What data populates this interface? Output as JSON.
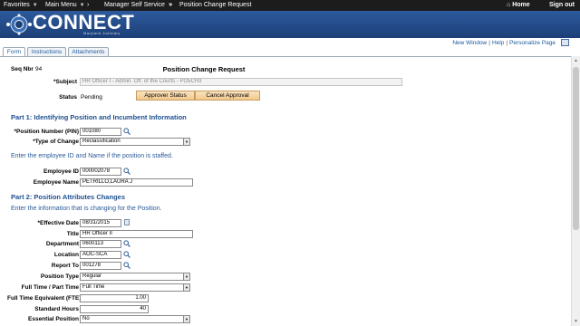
{
  "topbar": {
    "favorites": "Favorites",
    "main_menu": "Main Menu",
    "manager_self_service": "Manager Self Service",
    "page": "Position Change Request",
    "home": "Home",
    "sign_out": "Sign out"
  },
  "brand": {
    "name": "CONNECT",
    "subtitle": "Maryland Judiciary"
  },
  "tabs": [
    "Form",
    "Instructions",
    "Attachments"
  ],
  "links": [
    "New Window",
    "Help",
    "Personalize Page"
  ],
  "form": {
    "title": "Position Change Request",
    "seq_label": "Seq Nbr",
    "seq_value": "94",
    "subject_label": "*Subject",
    "subject_value": "HR Officer I - Admin. Off. of the Courts - PO5CH3",
    "status_label": "Status",
    "status_value": "Pending",
    "approver_status_btn": "Approver Status",
    "cancel_approval_btn": "Cancel Approval"
  },
  "part1": {
    "heading": "Part 1: Identifying Position and Incumbent Information",
    "position_number_label": "*Position Number (PIN)",
    "position_number_value": "001080",
    "type_of_change_label": "*Type of Change",
    "type_of_change_value": "Reclassification",
    "instruction": "Enter the employee ID and Name if the position is staffed.",
    "employee_id_label": "Employee ID",
    "employee_id_value": "000002078",
    "employee_name_label": "Employee Name",
    "employee_name_value": "PETRILLO,LAURA J"
  },
  "part2": {
    "heading": "Part 2: Position Attributes Changes",
    "instruction": "Enter the information that is changing for the Position.",
    "effective_date_label": "*Effective Date",
    "effective_date_value": "08/31/2015",
    "title_label": "Title",
    "title_value": "HR Officer II",
    "department_label": "Department",
    "department_value": "0600113",
    "location_label": "Location",
    "location_value": "AOC-SCA",
    "report_to_label": "Report To",
    "report_to_value": "001278",
    "position_type_label": "Position Type",
    "position_type_value": "Regular",
    "full_part_time_label": "Full Time / Part Time",
    "full_part_time_value": "Full Time",
    "fte_label": "Full Time Equivalent (FTE)",
    "fte_value": "1.00",
    "standard_hours_label": "Standard Hours",
    "standard_hours_value": "40",
    "essential_position_label": "Essential Position",
    "essential_position_value": "No"
  },
  "icons": {
    "lookup": "magnifier-icon",
    "calendar": "calendar-icon",
    "home": "home-icon",
    "dropdown": "chevron-down-icon"
  },
  "colors": {
    "banner": "#2c5a9c",
    "section_heading": "#1d4f91",
    "link": "#1d5aa0",
    "button": "#f2c98c"
  }
}
